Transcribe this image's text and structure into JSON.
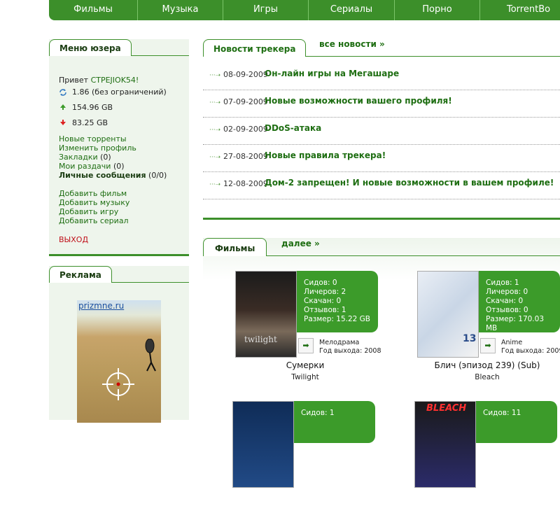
{
  "nav": {
    "tabs": [
      "Фильмы",
      "Музыка",
      "Игры",
      "Сериалы",
      "Порно",
      "TorrentBo"
    ]
  },
  "user_menu": {
    "title": "Меню юзера",
    "greeting_prefix": "Привет ",
    "username": "CTPEJIOK54!",
    "ratio": "1.86 (без ограничений)",
    "uploaded": "154.96 GB",
    "downloaded": "83.25 GB",
    "links": {
      "new_torrents": "Новые торренты",
      "edit_profile": "Изменить профиль",
      "bookmarks": "Закладки",
      "bookmarks_count": "(0)",
      "my_releases": "Мои раздачи",
      "my_releases_count": "(0)",
      "messages": "Личные сообщения",
      "messages_count": "(0/0)"
    },
    "add_links": {
      "film": "Добавить фильм",
      "music": "Добавить музыку",
      "game": "Добавить игру",
      "series": "Добавить сериал"
    },
    "exit": "ВЫХОД"
  },
  "ad": {
    "title": "Реклама",
    "site": "prizmne.ru"
  },
  "news": {
    "title": "Новости трекера",
    "all_link": "все новости »",
    "items": [
      {
        "date": "08-09-2009",
        "title": "Он-лайн игры на Мегашаре"
      },
      {
        "date": "07-09-2009",
        "title": "Новые возможности вашего профиля!"
      },
      {
        "date": "02-09-2009",
        "title": "DDoS-атака"
      },
      {
        "date": "27-08-2009",
        "title": "Новые правила трекера!"
      },
      {
        "date": "12-08-2009",
        "title": "Дом-2 запрещен! И новые возможности в вашем профиле!"
      }
    ]
  },
  "films": {
    "title": "Фильмы",
    "more_link": "далее »",
    "cards": [
      {
        "seeds": "Сидов: 0",
        "leechers": "Личеров: 2",
        "downloaded": "Скачан: 0",
        "reviews": "Отзывов: 1",
        "size": "Размер: 15.22 GB",
        "genre": "Мелодрама",
        "year": "Год выхода: 2008",
        "title": "Сумерки",
        "original": "Twilight",
        "poster_text": "twilight"
      },
      {
        "seeds": "Сидов: 1",
        "leechers": "Личеров: 0",
        "downloaded": "Скачан: 0",
        "reviews": "Отзывов: 0",
        "size": "Размер: 170.03 MB",
        "genre": "Anime",
        "year": "Год выхода: 2009",
        "title": "Блич (эпизод 239) (Sub)",
        "original": "Bleach",
        "poster_text": "13"
      },
      {
        "seeds": "Сидов: 1"
      },
      {
        "seeds": "Сидов: 11",
        "poster_text": "BLEACH"
      }
    ]
  },
  "colors": {
    "brand": "#3c8f2a",
    "link": "#1e6e12",
    "exit": "#c0111a"
  }
}
